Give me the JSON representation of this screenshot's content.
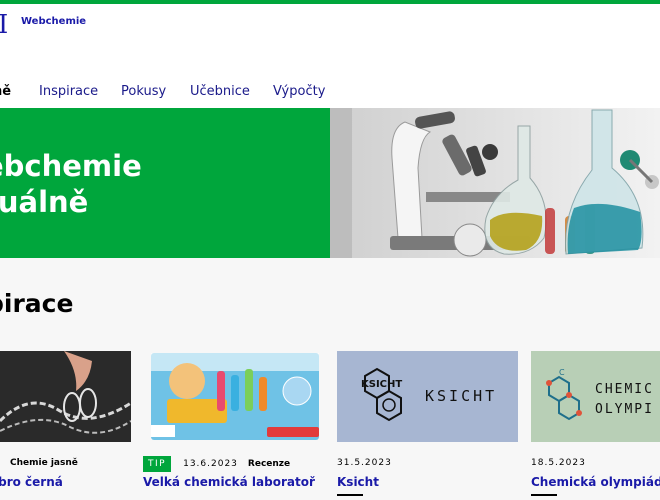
{
  "header": {
    "logo_glyph": "I",
    "brand": "Webchemie"
  },
  "nav": {
    "items": [
      {
        "label": "ně",
        "active": true
      },
      {
        "label": "Inspirace"
      },
      {
        "label": "Pokusy"
      },
      {
        "label": "Učebnice"
      },
      {
        "label": "Výpočty"
      }
    ]
  },
  "hero": {
    "title": "ebchemie\ntuálně"
  },
  "section": {
    "title": "pirace"
  },
  "cards": [
    {
      "tag": "",
      "date": "",
      "category": "Chemie jasně",
      "title": "íbro černá"
    },
    {
      "tag": "TIP",
      "date": "13.6.2023",
      "category": "Recenze",
      "title": "Velká chemická laboratoř"
    },
    {
      "tag": "",
      "date": "31.5.2023",
      "category": "",
      "title": "Ksicht",
      "image_text": "KSICHT",
      "logo_text": "KSICHT"
    },
    {
      "tag": "",
      "date": "18.5.2023",
      "category": "",
      "title": "Chemická olympiáda",
      "image_text": "CHEMIC\nOLYMPI",
      "logo_text": "C"
    }
  ],
  "colors": {
    "accent": "#00a63c",
    "link": "#1a1aa8",
    "card_bg_ksicht": "#a7b6d2",
    "card_bg_olymp": "#b8cfb6"
  }
}
